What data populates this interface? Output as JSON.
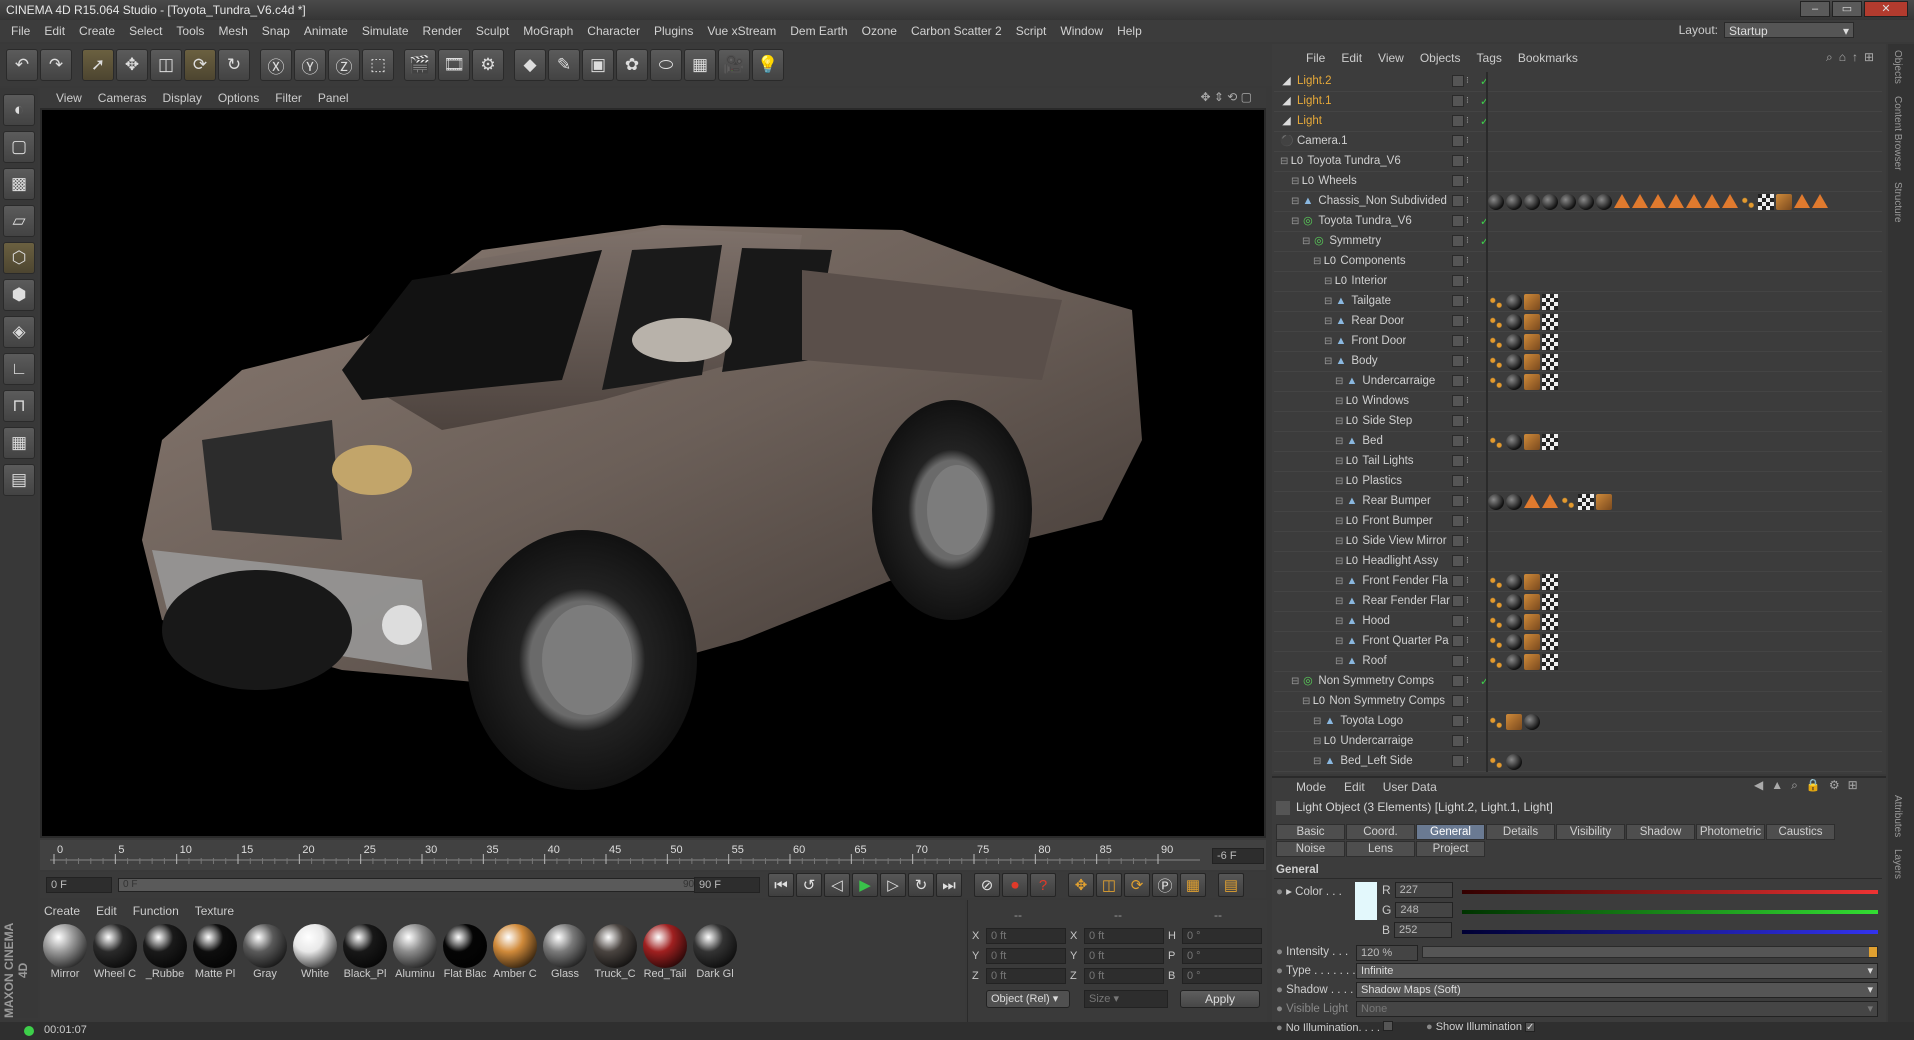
{
  "window": {
    "title": "CINEMA 4D R15.064 Studio - [Toyota_Tundra_V6.c4d *]"
  },
  "menubar": [
    "File",
    "Edit",
    "Create",
    "Select",
    "Tools",
    "Mesh",
    "Snap",
    "Animate",
    "Simulate",
    "Render",
    "Sculpt",
    "MoGraph",
    "Character",
    "Plugins",
    "Vue xStream",
    "Dem Earth",
    "Ozone",
    "Carbon Scatter 2",
    "Script",
    "Window",
    "Help"
  ],
  "layout": {
    "label": "Layout:",
    "value": "Startup"
  },
  "viewport_menu": [
    "View",
    "Cameras",
    "Display",
    "Options",
    "Filter",
    "Panel"
  ],
  "timeline": {
    "ticks": [
      "0",
      "5",
      "10",
      "15",
      "20",
      "25",
      "30",
      "35",
      "40",
      "45",
      "50",
      "55",
      "60",
      "65",
      "70",
      "75",
      "80",
      "85",
      "90"
    ],
    "end_field": "-6 F",
    "start": "0 F",
    "range_start": "0 F",
    "range_end": "90 F",
    "end": "90 F"
  },
  "materials": {
    "menu": [
      "Create",
      "Edit",
      "Function",
      "Texture"
    ],
    "items": [
      {
        "name": "Mirror",
        "color": "#9a9a9a"
      },
      {
        "name": "Wheel C",
        "color": "#2a2a2a"
      },
      {
        "name": "_Rubbe",
        "color": "#1a1a1a"
      },
      {
        "name": "Matte Pl",
        "color": "#0e0e0e"
      },
      {
        "name": "Gray",
        "color": "#5a5a5a"
      },
      {
        "name": "White",
        "color": "#e8e8e8"
      },
      {
        "name": "Black_Pl",
        "color": "#181818"
      },
      {
        "name": "Aluminu",
        "color": "#8c8c8c"
      },
      {
        "name": "Flat Blac",
        "color": "#050505"
      },
      {
        "name": "Amber C",
        "color": "#d08a3a"
      },
      {
        "name": "Glass",
        "color": "#7a7a7a"
      },
      {
        "name": "Truck_C",
        "color": "#4a4440"
      },
      {
        "name": "Red_Tail",
        "color": "#a02020"
      },
      {
        "name": "Dark Gl",
        "color": "#333"
      }
    ]
  },
  "coords": {
    "headers": [
      "--",
      "--",
      "--"
    ],
    "rows": [
      {
        "a": "X",
        "av": "0 ft",
        "b": "X",
        "bv": "0 ft",
        "c": "H",
        "cv": "0 °"
      },
      {
        "a": "Y",
        "av": "0 ft",
        "b": "Y",
        "bv": "0 ft",
        "c": "P",
        "cv": "0 °"
      },
      {
        "a": "Z",
        "av": "0 ft",
        "b": "Z",
        "bv": "0 ft",
        "c": "B",
        "cv": "0 °"
      }
    ],
    "mode": "Object (Rel)",
    "size": "Size",
    "apply": "Apply"
  },
  "status": {
    "time": "00:01:07"
  },
  "objects": {
    "menu": [
      "File",
      "Edit",
      "View",
      "Objects",
      "Tags",
      "Bookmarks"
    ],
    "rows": [
      {
        "name": "Light.2",
        "indent": 0,
        "type": "light",
        "tags": []
      },
      {
        "name": "Light.1",
        "indent": 0,
        "type": "light",
        "tags": []
      },
      {
        "name": "Light",
        "indent": 0,
        "type": "light",
        "tags": []
      },
      {
        "name": "Camera.1",
        "indent": 0,
        "type": "camera",
        "tags": []
      },
      {
        "name": "Toyota Tundra_V6",
        "indent": 0,
        "type": "null",
        "tags": []
      },
      {
        "name": "Wheels",
        "indent": 1,
        "type": "null",
        "tags": []
      },
      {
        "name": "Chassis_Non Subdivided",
        "indent": 1,
        "type": "poly",
        "tags": [
          "ball",
          "ball",
          "ball",
          "ball",
          "ball",
          "ball",
          "ball",
          "cone",
          "cone",
          "cone",
          "cone",
          "cone",
          "cone",
          "cone",
          "dots",
          "chk",
          "phong",
          "cone",
          "cone"
        ]
      },
      {
        "name": "Toyota Tundra_V6",
        "indent": 1,
        "type": "sym",
        "tags": []
      },
      {
        "name": "Symmetry",
        "indent": 2,
        "type": "sym",
        "tags": []
      },
      {
        "name": "Components",
        "indent": 3,
        "type": "null",
        "tags": []
      },
      {
        "name": "Interior",
        "indent": 4,
        "type": "null",
        "tags": []
      },
      {
        "name": "Tailgate",
        "indent": 4,
        "type": "poly",
        "tags": [
          "dots",
          "ball",
          "phong",
          "chk"
        ]
      },
      {
        "name": "Rear Door",
        "indent": 4,
        "type": "poly",
        "tags": [
          "dots",
          "ball",
          "phong",
          "chk"
        ]
      },
      {
        "name": "Front Door",
        "indent": 4,
        "type": "poly",
        "tags": [
          "dots",
          "ball",
          "phong",
          "chk"
        ]
      },
      {
        "name": "Body",
        "indent": 4,
        "type": "poly",
        "tags": [
          "dots",
          "ball",
          "phong",
          "chk"
        ]
      },
      {
        "name": "Undercarraige",
        "indent": 5,
        "type": "poly",
        "tags": [
          "dots",
          "ball",
          "phong",
          "chk"
        ]
      },
      {
        "name": "Windows",
        "indent": 5,
        "type": "null",
        "tags": []
      },
      {
        "name": "Side Step",
        "indent": 5,
        "type": "null",
        "tags": []
      },
      {
        "name": "Bed",
        "indent": 5,
        "type": "poly",
        "tags": [
          "dots",
          "ball",
          "phong",
          "chk"
        ]
      },
      {
        "name": "Tail Lights",
        "indent": 5,
        "type": "null",
        "tags": []
      },
      {
        "name": "Plastics",
        "indent": 5,
        "type": "null",
        "tags": []
      },
      {
        "name": "Rear Bumper",
        "indent": 5,
        "type": "poly",
        "tags": [
          "ball",
          "ball",
          "cone",
          "cone",
          "dots",
          "chk",
          "phong"
        ]
      },
      {
        "name": "Front Bumper",
        "indent": 5,
        "type": "null",
        "tags": []
      },
      {
        "name": "Side View Mirror",
        "indent": 5,
        "type": "null",
        "tags": []
      },
      {
        "name": "Headlight Assy",
        "indent": 5,
        "type": "null",
        "tags": []
      },
      {
        "name": "Front Fender Fla",
        "indent": 5,
        "type": "poly",
        "tags": [
          "dots",
          "ball",
          "phong",
          "chk"
        ]
      },
      {
        "name": "Rear Fender Flar",
        "indent": 5,
        "type": "poly",
        "tags": [
          "dots",
          "ball",
          "phong",
          "chk"
        ]
      },
      {
        "name": "Hood",
        "indent": 5,
        "type": "poly",
        "tags": [
          "dots",
          "ball",
          "phong",
          "chk"
        ]
      },
      {
        "name": "Front Quarter Pa",
        "indent": 5,
        "type": "poly",
        "tags": [
          "dots",
          "ball",
          "phong",
          "chk"
        ]
      },
      {
        "name": "Roof",
        "indent": 5,
        "type": "poly",
        "tags": [
          "dots",
          "ball",
          "phong",
          "chk"
        ]
      },
      {
        "name": "Non Symmetry Comps",
        "indent": 1,
        "type": "sym",
        "tags": []
      },
      {
        "name": "Non Symmetry Comps",
        "indent": 2,
        "type": "null",
        "tags": []
      },
      {
        "name": "Toyota Logo",
        "indent": 3,
        "type": "poly",
        "tags": [
          "dots",
          "phong",
          "ball"
        ]
      },
      {
        "name": "Undercarraige",
        "indent": 3,
        "type": "null",
        "tags": []
      },
      {
        "name": "Bed_Left Side",
        "indent": 3,
        "type": "poly",
        "tags": [
          "dots",
          "ball"
        ]
      }
    ]
  },
  "attributes": {
    "menu": [
      "Mode",
      "Edit",
      "User Data"
    ],
    "title": "Light Object (3 Elements) [Light.2, Light.1, Light]",
    "tabs_row1": [
      "Basic",
      "Coord.",
      "General",
      "Details",
      "Visibility",
      "Shadow",
      "Photometric",
      "Caustics"
    ],
    "tabs_row2": [
      "Noise",
      "Lens",
      "Project"
    ],
    "active_tab": "General",
    "section": "General",
    "color_label": "Color",
    "r_label": "R",
    "r": "227",
    "g_label": "G",
    "g": "248",
    "b_label": "B",
    "b": "252",
    "swatch": "#e3f8fc",
    "intensity_label": "Intensity . . .",
    "intensity": "120 %",
    "type_label": "Type",
    "type": "Infinite",
    "shadow_label": "Shadow",
    "shadow": "Shadow Maps (Soft)",
    "visible_label": "Visible Light",
    "visible": "None",
    "noillum_label": "No Illumination. . . .",
    "showillum_label": "Show Illumination"
  },
  "sidetabs": [
    "Objects",
    "Content Browser",
    "Structure",
    "Attributes",
    "Layers"
  ]
}
